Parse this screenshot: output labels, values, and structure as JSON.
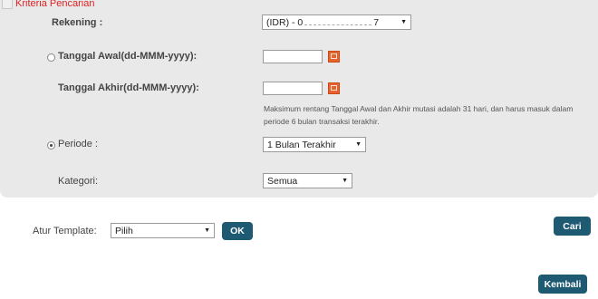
{
  "form": {
    "title": "Kriteria Pencarian",
    "rekening_label": "Rekening :",
    "rekening_prefix": "(IDR) - 0",
    "rekening_suffix": "7",
    "tanggal_awal_label": "Tanggal Awal(dd-MMM-yyyy):",
    "tanggal_awal_value": "",
    "tanggal_akhir_label": "Tanggal Akhir(dd-MMM-yyyy):",
    "tanggal_akhir_value": "",
    "note": "Maksimum rentang Tanggal Awal dan Akhir mutasi adalah 31 hari, dan harus masuk dalam periode 6 bulan transaksi terakhir.",
    "periode_label": "Periode :",
    "periode_value": "1 Bulan Terakhir",
    "kategori_label": "Kategori:",
    "kategori_value": "Semua",
    "selected_mode": "periode"
  },
  "template": {
    "label": "Atur Template:",
    "select_value": "Pilih",
    "ok_label": "OK"
  },
  "actions": {
    "search_label": "Cari",
    "back_label": "Kembali"
  },
  "colors": {
    "title": "#dd2222",
    "button": "#1f5a73",
    "calendar_button": "#e8632c",
    "panel_bg": "#e9e9e9"
  }
}
